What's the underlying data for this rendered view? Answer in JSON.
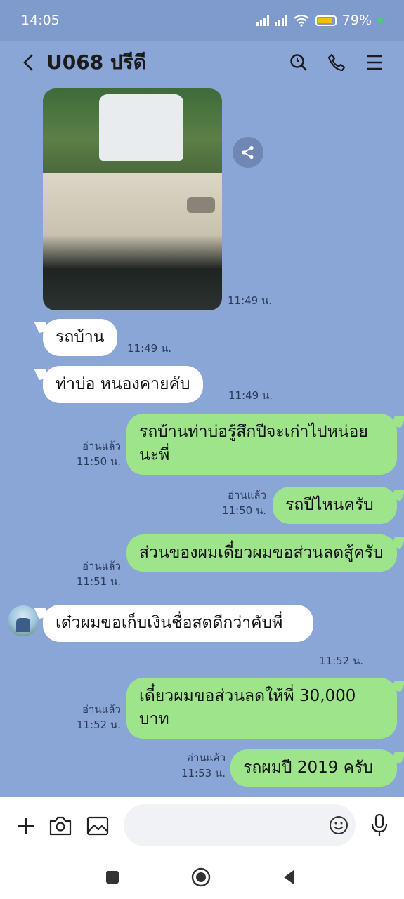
{
  "status_bar": {
    "time": "14:05",
    "battery": "79%"
  },
  "header": {
    "title": "U068 ปรีดี"
  },
  "messages": {
    "photo_time": "11:49 น.",
    "m1": {
      "text": "รถบ้าน",
      "time": "11:49 น."
    },
    "m2": {
      "text": "ท่าบ่อ  หนองคายคับ",
      "time": "11:49 น."
    },
    "m3": {
      "text": "รถบ้านท่าบ่อรู้สึกปีจะเก่าไปหน่อยนะพี่",
      "read": "อ่านแล้ว",
      "time": "11:50 น."
    },
    "m4": {
      "text": "รถปีไหนครับ",
      "read": "อ่านแล้ว",
      "time": "11:50 น."
    },
    "m5": {
      "text": "ส่วนของผมเดี๋ยวผมขอส่วนลดสู้ครับ",
      "read": "อ่านแล้ว",
      "time": "11:51 น."
    },
    "m6": {
      "text": "เด๋วผมขอเก็บเงินชื่อสดดีกว่าคับพี่",
      "time": "11:52 น."
    },
    "m7": {
      "text": "เดี๋ยวผมขอส่วนลดให้พี่ 30,000 บาท",
      "read": "อ่านแล้ว",
      "time": "11:52 น."
    },
    "m8": {
      "text": "รถผมปี 2019 ครับ",
      "read": "อ่านแล้ว",
      "time": "11:53 น."
    }
  },
  "input": {
    "placeholder": "",
    "value": ""
  },
  "icons": {
    "back": "chevron-left-icon",
    "search": "search-icon",
    "call": "phone-icon",
    "menu": "menu-icon",
    "share": "share-icon",
    "add": "plus-icon",
    "camera": "camera-icon",
    "gallery": "image-icon",
    "emoji": "smiley-icon",
    "mic": "microphone-icon"
  },
  "colors": {
    "chat_bg": "#8aa6d6",
    "outgoing": "#9de48a",
    "incoming": "#ffffff",
    "status_bar": "#7f9acd"
  }
}
